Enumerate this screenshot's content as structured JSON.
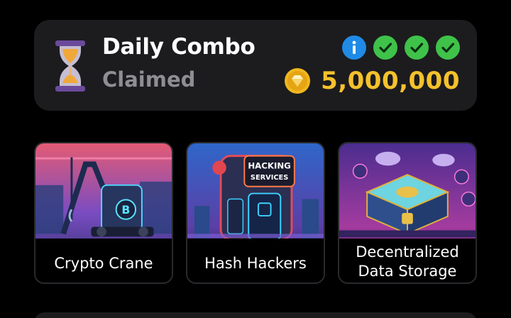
{
  "daily_combo": {
    "title": "Daily Combo",
    "status": "Claimed",
    "reward": "5,000,000",
    "icons": [
      "hourglass-icon",
      "info-icon",
      "check-icon",
      "check-icon",
      "check-icon",
      "coin-icon"
    ],
    "colors": {
      "reward": "#f5c12c",
      "check": "#3fc24a",
      "info": "#1f8be6",
      "status": "#8e8e93"
    }
  },
  "cards": [
    {
      "label_lines": [
        "Crypto Crane"
      ]
    },
    {
      "label_lines": [
        "Hash Hackers"
      ],
      "sign_lines": [
        "HACKING",
        "SERVICES"
      ]
    },
    {
      "label_lines": [
        "Decentralized",
        "Data Storage"
      ]
    }
  ]
}
